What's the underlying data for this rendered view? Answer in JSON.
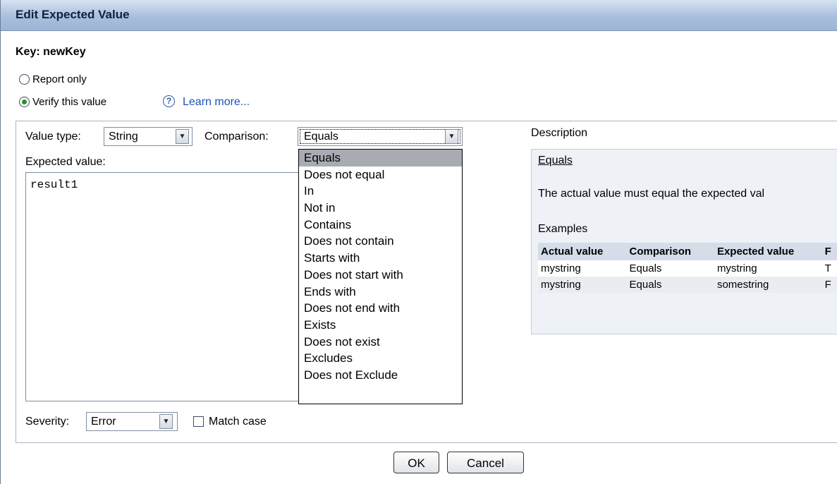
{
  "dialog": {
    "title": "Edit Expected Value"
  },
  "key_label": "Key: newKey",
  "mode": {
    "report_only_label": "Report only",
    "verify_label": "Verify this value",
    "selected": "verify",
    "help_icon": "help-circle-icon",
    "learn_more_label": "Learn more..."
  },
  "value_type": {
    "label": "Value type:",
    "value": "String"
  },
  "comparison": {
    "label": "Comparison:",
    "value": "Equals",
    "options": [
      "Equals",
      "Does not equal",
      "In",
      "Not in",
      "Contains",
      "Does not contain",
      "Starts with",
      "Does not start with",
      "Ends with",
      "Does not end with",
      "Exists",
      "Does not exist",
      "Excludes",
      "Does not Exclude"
    ],
    "highlighted": "Equals"
  },
  "expected": {
    "label": "Expected value:",
    "value": "result1"
  },
  "description": {
    "heading": "Description",
    "title": "Equals",
    "text": "The actual value must equal the expected val",
    "examples_label": "Examples",
    "columns": [
      "Actual value",
      "Comparison",
      "Expected value",
      "F"
    ],
    "rows": [
      [
        "mystring",
        "Equals",
        "mystring",
        "T"
      ],
      [
        "mystring",
        "Equals",
        "somestring",
        "F"
      ]
    ]
  },
  "severity": {
    "label": "Severity:",
    "value": "Error"
  },
  "match_case": {
    "label": "Match case",
    "checked": false
  },
  "buttons": {
    "ok": "OK",
    "cancel": "Cancel"
  },
  "colors": {
    "title_bar": "#a9bfdc",
    "link": "#1c53b5",
    "radio_dot": "#2a8f2a",
    "dropdown_highlight": "#a8acb2",
    "description_bg": "#eef2f7"
  }
}
